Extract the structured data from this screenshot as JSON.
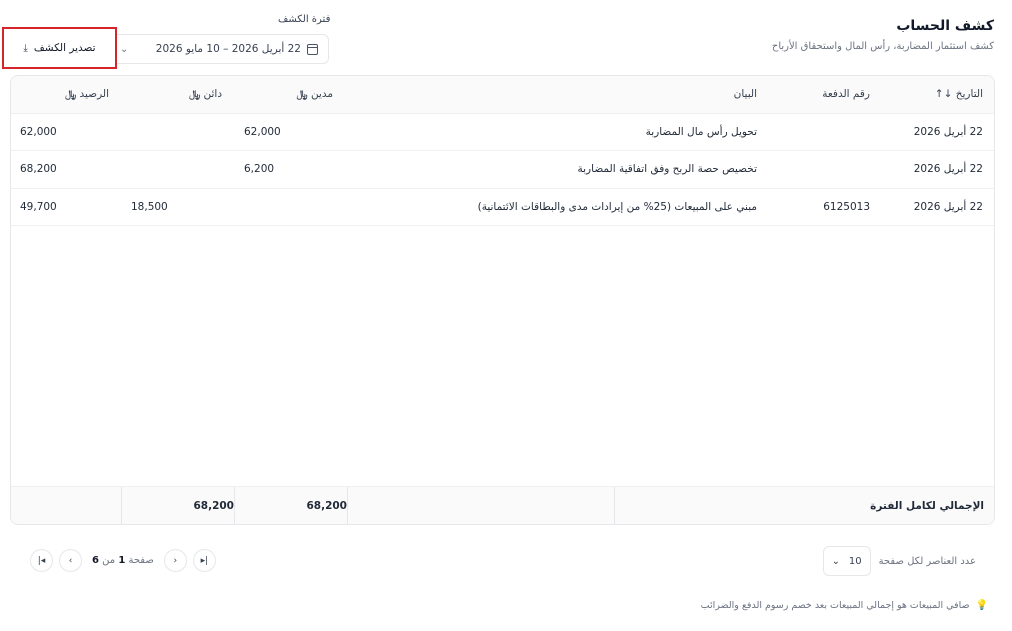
{
  "header": {
    "title": "كشف الحساب",
    "subtitle": "كشف استثمار المضاربة، رأس المال واستحقاق الأرباح"
  },
  "period": {
    "label": "فترة الكشف",
    "value": "22 أبريل 2026 – 10 مايو 2026"
  },
  "export": {
    "label": "تصدير الكشف"
  },
  "table": {
    "headers": {
      "date": "التاريخ ↓↑",
      "payment_no": "رقم الدفعة",
      "description": "البيان",
      "debit": "مدين",
      "credit": "دائن",
      "balance": "الرصيد"
    },
    "currency_symbol": "﷼",
    "rows": [
      {
        "date": "22 أبريل 2026",
        "payment_no": "",
        "description": "تحويل رأس مال المضاربة",
        "debit": "62,000",
        "credit": "",
        "balance": "62,000"
      },
      {
        "date": "22 أبريل 2026",
        "payment_no": "",
        "description": "تخصيص حصة الربح وفق اتفاقية المضاربة",
        "debit": "6,200",
        "credit": "",
        "balance": "68,200"
      },
      {
        "date": "22 أبريل 2026",
        "payment_no": "6125013",
        "description": "مبني على المبيعات (25% من إيرادات مدى والبطاقات الائتمانية)",
        "debit": "",
        "credit": "18,500",
        "balance": "49,700"
      }
    ],
    "footer": {
      "label": "الإجمالي لكامل الفترة",
      "debit_total": "68,200",
      "credit_total": "68,200"
    }
  },
  "pagination": {
    "page_prefix": "صفحة",
    "current": "1",
    "of": "من",
    "total": "6",
    "per_page_label": "عدد العناصر لكل صفحة",
    "per_page_value": "10"
  },
  "note": "صافي المبيعات هو إجمالي المبيعات بعد خصم رسوم الدفع والضرائب"
}
